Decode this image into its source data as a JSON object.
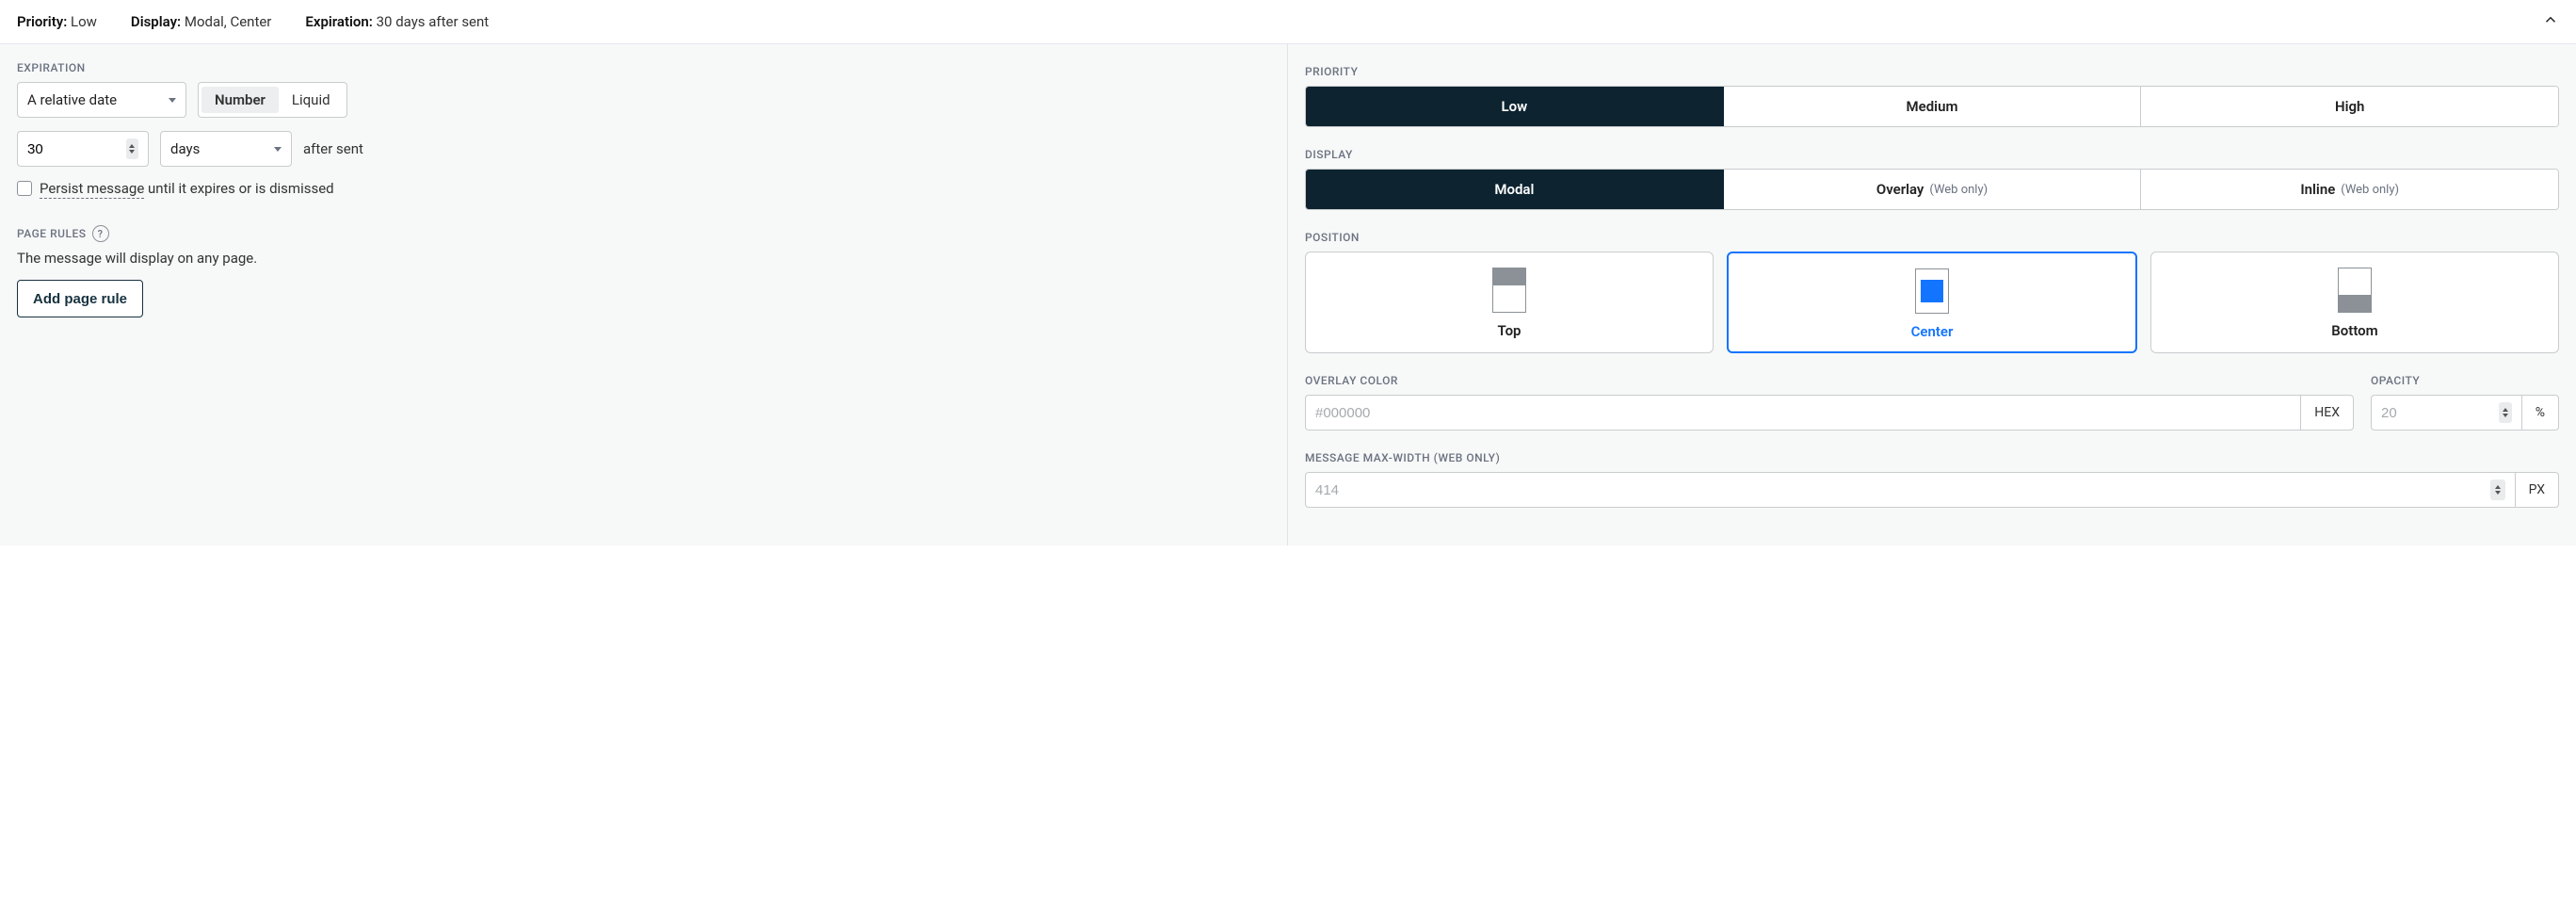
{
  "summary": {
    "priority_label": "Priority:",
    "priority_value": "Low",
    "display_label": "Display:",
    "display_value": "Modal, Center",
    "expiration_label": "Expiration:",
    "expiration_value": "30 days after sent"
  },
  "left": {
    "expiration_heading": "EXPIRATION",
    "rel_date_select": "A relative date",
    "toggle_number": "Number",
    "toggle_liquid": "Liquid",
    "duration_value": "30",
    "duration_unit": "days",
    "after_sent_text": "after sent",
    "persist_underlined": "Persist message",
    "persist_rest": " until it expires or is dismissed",
    "page_rules_heading": "PAGE RULES",
    "page_rules_desc": "The message will display on any page.",
    "add_rule_btn": "Add page rule"
  },
  "right": {
    "priority_heading": "PRIORITY",
    "priority_options": [
      "Low",
      "Medium",
      "High"
    ],
    "priority_selected": "Low",
    "display_heading": "DISPLAY",
    "display_options": [
      {
        "label": "Modal",
        "suffix": ""
      },
      {
        "label": "Overlay",
        "suffix": "(Web only)"
      },
      {
        "label": "Inline",
        "suffix": "(Web only)"
      }
    ],
    "display_selected": "Modal",
    "position_heading": "POSITION",
    "position_options": [
      "Top",
      "Center",
      "Bottom"
    ],
    "position_selected": "Center",
    "overlay_color_heading": "OVERLAY COLOR",
    "overlay_color_placeholder": "#000000",
    "overlay_color_suffix": "HEX",
    "opacity_heading": "OPACITY",
    "opacity_placeholder": "20",
    "opacity_suffix": "%",
    "maxwidth_heading": "MESSAGE MAX-WIDTH (WEB ONLY)",
    "maxwidth_placeholder": "414",
    "maxwidth_suffix": "PX"
  }
}
